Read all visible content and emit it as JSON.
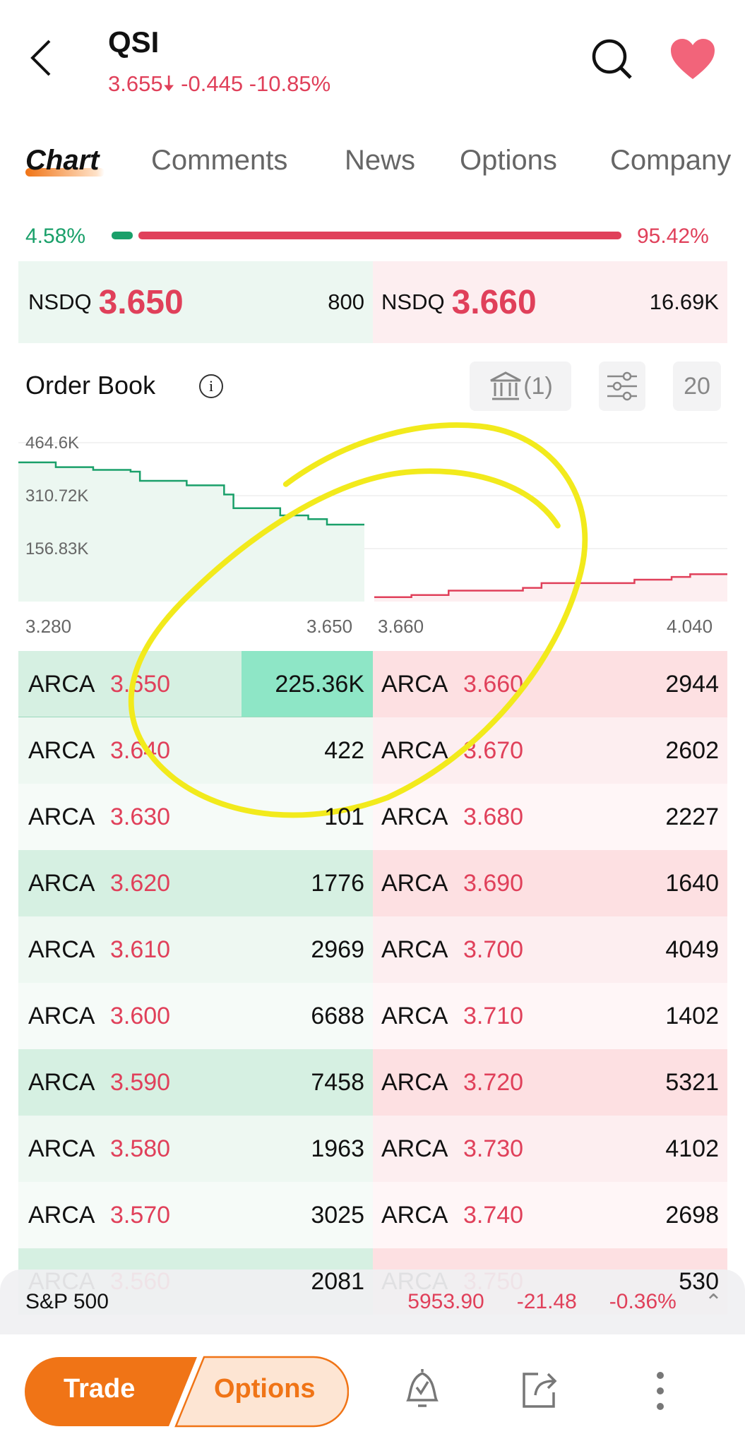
{
  "header": {
    "symbol": "QSI",
    "price": "3.655",
    "change": "-0.445",
    "change_pct": "-10.85%",
    "direction_icon": "arrow-down-icon"
  },
  "tabs": [
    {
      "label": "Chart",
      "active": true
    },
    {
      "label": "Comments"
    },
    {
      "label": "News"
    },
    {
      "label": "Options"
    },
    {
      "label": "Company"
    }
  ],
  "ratio": {
    "bid_pct": "4.58%",
    "ask_pct": "95.42%",
    "bid_fraction": 0.0458
  },
  "best": {
    "bid_exchange": "NSDQ",
    "bid_price": "3.650",
    "bid_size": "800",
    "ask_exchange": "NSDQ",
    "ask_price": "3.660",
    "ask_size": "16.69K"
  },
  "order_book": {
    "title": "Order Book",
    "exchanges_label": "(1)",
    "depth_label": "20"
  },
  "chart_data": {
    "type": "line",
    "y_ticks": [
      "464.6K",
      "310.72K",
      "156.83K"
    ],
    "x_labels": [
      "3.280",
      "3.650",
      "3.660",
      "4.040"
    ],
    "series": [
      {
        "side": "bid",
        "color": "#1aa06a",
        "points": [
          [
            3.28,
            407
          ],
          [
            3.32,
            393
          ],
          [
            3.36,
            385
          ],
          [
            3.4,
            380
          ],
          [
            3.41,
            353
          ],
          [
            3.46,
            340
          ],
          [
            3.5,
            313
          ],
          [
            3.51,
            273
          ],
          [
            3.56,
            252
          ],
          [
            3.59,
            241
          ],
          [
            3.61,
            225
          ],
          [
            3.65,
            225
          ]
        ]
      },
      {
        "side": "ask",
        "color": "#e0405a",
        "points": [
          [
            3.66,
            13
          ],
          [
            3.7,
            19
          ],
          [
            3.74,
            32
          ],
          [
            3.82,
            40
          ],
          [
            3.84,
            54
          ],
          [
            3.94,
            64
          ],
          [
            3.98,
            72
          ],
          [
            4.0,
            80
          ],
          [
            4.04,
            80
          ]
        ]
      }
    ]
  },
  "bids": [
    [
      "ARCA",
      "3.650",
      "225.36K"
    ],
    [
      "ARCA",
      "3.640",
      "422"
    ],
    [
      "ARCA",
      "3.630",
      "101"
    ],
    [
      "ARCA",
      "3.620",
      "1776"
    ],
    [
      "ARCA",
      "3.610",
      "2969"
    ],
    [
      "ARCA",
      "3.600",
      "6688"
    ],
    [
      "ARCA",
      "3.590",
      "7458"
    ],
    [
      "ARCA",
      "3.580",
      "1963"
    ],
    [
      "ARCA",
      "3.570",
      "3025"
    ],
    [
      "ARCA",
      "3.560",
      "2081"
    ]
  ],
  "asks": [
    [
      "ARCA",
      "3.660",
      "2944"
    ],
    [
      "ARCA",
      "3.670",
      "2602"
    ],
    [
      "ARCA",
      "3.680",
      "2227"
    ],
    [
      "ARCA",
      "3.690",
      "1640"
    ],
    [
      "ARCA",
      "3.700",
      "4049"
    ],
    [
      "ARCA",
      "3.710",
      "1402"
    ],
    [
      "ARCA",
      "3.720",
      "5321"
    ],
    [
      "ARCA",
      "3.730",
      "4102"
    ],
    [
      "ARCA",
      "3.740",
      "2698"
    ],
    [
      "ARCA",
      "3.750",
      "530"
    ]
  ],
  "index_bar": {
    "name": "S&P 500",
    "value": "5953.90",
    "change": "-21.48",
    "change_pct": "-0.36%"
  },
  "bottom": {
    "trade": "Trade",
    "options": "Options"
  },
  "colors": {
    "accent": "#f07416",
    "up": "#1aa06a",
    "down": "#e0405a",
    "annotation": "#f2ea1c"
  }
}
